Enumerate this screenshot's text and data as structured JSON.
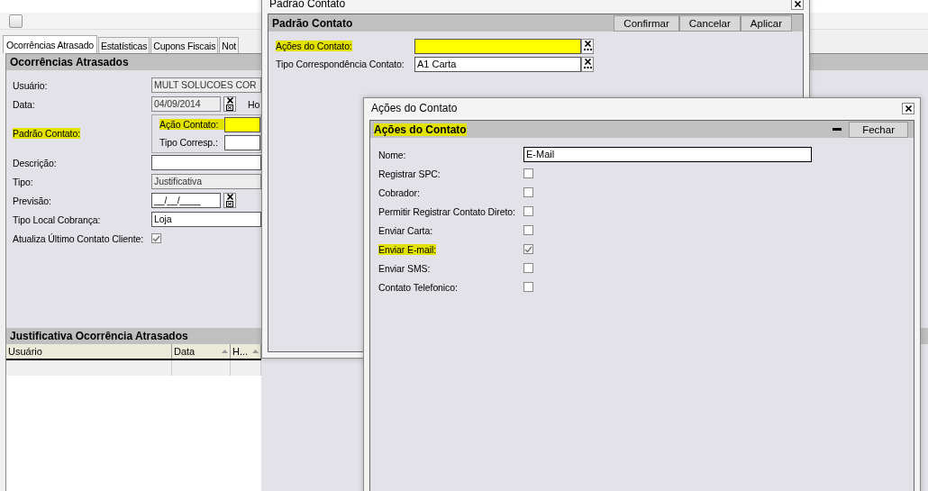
{
  "main": {
    "tabs": [
      {
        "label": "Ocorrências Atrasado",
        "selected": true
      },
      {
        "label": "Estatísticas",
        "selected": false
      },
      {
        "label": "Cupons Fiscais",
        "selected": false
      },
      {
        "label": "Not",
        "selected": false
      }
    ],
    "panel_title": "Ocorrências Atrasados",
    "fields": [
      {
        "kind": "text",
        "label": "Usuário:",
        "value": "MULT SOLUCOES COR",
        "readonly": true,
        "highlighted": false
      },
      {
        "kind": "date",
        "label": "Data:",
        "value": "04/09/2014",
        "readonly": true,
        "suffix": "Ho",
        "highlighted": false
      },
      {
        "kind": "group",
        "label": "Padrão Contato:",
        "highlighted": true,
        "children": [
          {
            "label": "Ação Contato:",
            "highlighted": true
          },
          {
            "label": "Tipo Corresp.:",
            "highlighted": false
          }
        ]
      },
      {
        "kind": "text",
        "label": "Descrição:",
        "readonly": false,
        "highlighted": false
      },
      {
        "kind": "text",
        "label": "Tipo:",
        "value": "Justificativa",
        "readonly": true,
        "highlighted": false
      },
      {
        "kind": "date",
        "label": "Previsão:",
        "value": "__/__/____",
        "readonly": false,
        "highlighted": false
      },
      {
        "kind": "text",
        "label": "Tipo Local Cobrança:",
        "value": "Loja",
        "readonly": false,
        "highlighted": false
      },
      {
        "kind": "checkbox",
        "label": "Atualiza Último Contato Cliente:",
        "checked": true,
        "highlighted": false
      }
    ],
    "table": {
      "title": "Justificativa Ocorrência Atrasados",
      "columns": [
        {
          "label": "Usuário",
          "sortable": false
        },
        {
          "label": "Data",
          "sortable": true
        },
        {
          "label": "H...",
          "sortable": true
        }
      ]
    }
  },
  "padrao_dialog": {
    "title": "Padrão Contato",
    "panel_title": "Padrão Contato",
    "buttons": [
      "Confirmar",
      "Cancelar",
      "Aplicar"
    ],
    "fields": [
      {
        "label": "Ações do Contato:",
        "highlighted": true
      },
      {
        "label": "Tipo Correspondência Contato:",
        "value": "A1 Carta",
        "highlighted": false
      }
    ]
  },
  "acoes_dialog": {
    "title": "Ações do Contato",
    "panel_title": "Ações do Contato",
    "panel_title_highlighted": true,
    "buttons": [
      "Fechar"
    ],
    "fields": [
      {
        "kind": "text",
        "label": "Nome:",
        "value": "E-Mail",
        "highlighted": false
      },
      {
        "kind": "checkbox",
        "label": "Registrar SPC:",
        "checked": false,
        "highlighted": false
      },
      {
        "kind": "checkbox",
        "label": "Cobrador:",
        "checked": false,
        "highlighted": false
      },
      {
        "kind": "checkbox",
        "label": "Permitir Registrar Contato Direto:",
        "checked": false,
        "highlighted": false
      },
      {
        "kind": "checkbox",
        "label": "Enviar Carta:",
        "checked": false,
        "highlighted": false
      },
      {
        "kind": "checkbox",
        "label": "Enviar E-mail:",
        "checked": true,
        "highlighted": true
      },
      {
        "kind": "checkbox",
        "label": "Enviar SMS:",
        "checked": false,
        "highlighted": false
      },
      {
        "kind": "checkbox",
        "label": "Contato Telefonico:",
        "checked": false,
        "highlighted": false
      }
    ]
  }
}
